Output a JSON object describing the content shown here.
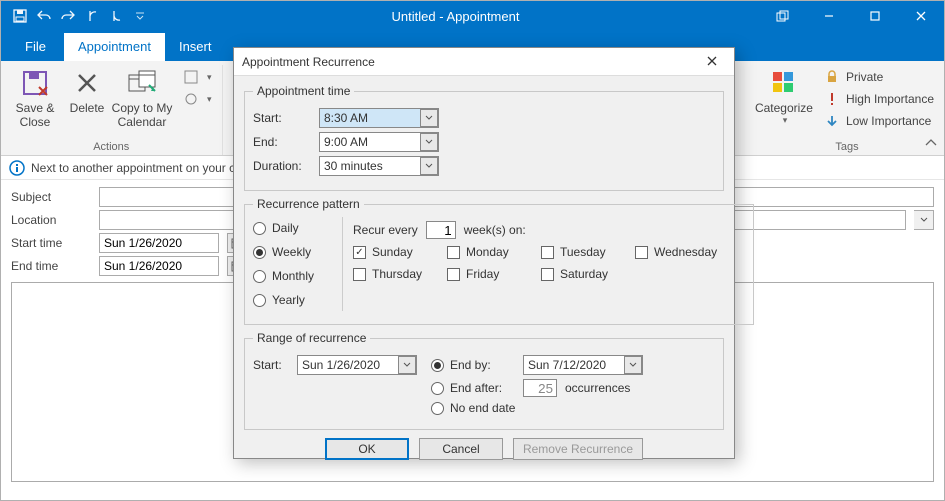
{
  "window": {
    "title": "Untitled  -  Appointment"
  },
  "qat_icons": {
    "save": "save-icon",
    "undo": "undo-icon",
    "redo": "redo-icon",
    "prev": "prev-icon",
    "next": "next-icon",
    "customize": "customize-icon"
  },
  "menubar": {
    "file": "File",
    "appointment": "Appointment",
    "insert": "Insert"
  },
  "ribbon": {
    "actions_group": "Actions",
    "save_close": "Save & Close",
    "delete": "Delete",
    "copy_calendar": "Copy to My Calendar",
    "categorize": "Categorize",
    "private": "Private",
    "high_importance": "High Importance",
    "low_importance": "Low Importance",
    "tags_group": "Tags"
  },
  "infostrip": {
    "text": "Next to another appointment on your c"
  },
  "form": {
    "subject_label": "Subject",
    "subject_value": "",
    "location_label": "Location",
    "location_value": "",
    "starttime_label": "Start time",
    "starttime_value": "Sun 1/26/2020",
    "endtime_label": "End time",
    "endtime_value": "Sun 1/26/2020"
  },
  "dialog": {
    "title": "Appointment Recurrence",
    "appt_time": {
      "legend": "Appointment time",
      "start_label": "Start:",
      "start_value": "8:30 AM",
      "end_label": "End:",
      "end_value": "9:00 AM",
      "duration_label": "Duration:",
      "duration_value": "30 minutes"
    },
    "pattern": {
      "legend": "Recurrence pattern",
      "daily": "Daily",
      "weekly": "Weekly",
      "monthly": "Monthly",
      "yearly": "Yearly",
      "recur_every_pre": "Recur every",
      "recur_every_value": "1",
      "recur_every_post": "week(s) on:",
      "days": {
        "sun": "Sunday",
        "mon": "Monday",
        "tue": "Tuesday",
        "wed": "Wednesday",
        "thu": "Thursday",
        "fri": "Friday",
        "sat": "Saturday"
      }
    },
    "range": {
      "legend": "Range of recurrence",
      "start_label": "Start:",
      "start_value": "Sun 1/26/2020",
      "endby_label": "End by:",
      "endby_value": "Sun 7/12/2020",
      "endafter_label": "End after:",
      "endafter_value": "25",
      "endafter_post": "occurrences",
      "noend_label": "No end date"
    },
    "buttons": {
      "ok": "OK",
      "cancel": "Cancel",
      "remove": "Remove Recurrence"
    }
  }
}
